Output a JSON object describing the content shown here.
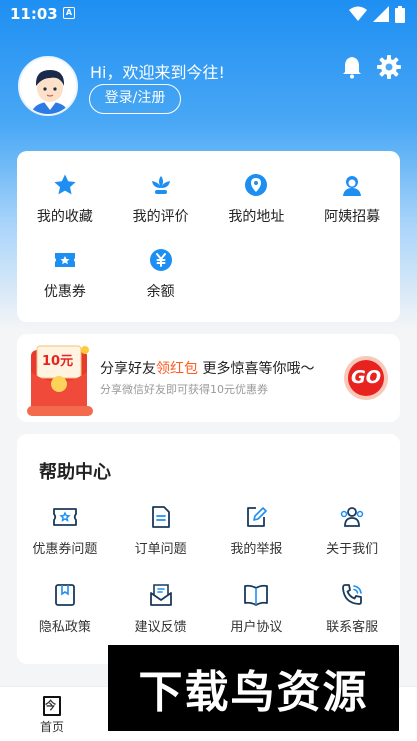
{
  "status_bar": {
    "time": "11:03",
    "indicator": "A"
  },
  "profile": {
    "greeting": "Hi，欢迎来到今往!",
    "login_label": "登录/注册"
  },
  "quick_actions": [
    {
      "label": "我的收藏",
      "icon": "star-icon"
    },
    {
      "label": "我的评价",
      "icon": "lotus-icon"
    },
    {
      "label": "我的地址",
      "icon": "location-pin-icon"
    },
    {
      "label": "阿姨招募",
      "icon": "nanny-icon"
    },
    {
      "label": "优惠券",
      "icon": "coupon-icon"
    },
    {
      "label": "余额",
      "icon": "yen-icon"
    }
  ],
  "promo": {
    "badge": "10元",
    "title_prefix": "分享好友",
    "title_highlight": "领红包",
    "title_suffix": " 更多惊喜等你哦～",
    "subtitle": "分享微信好友即可获得10元优惠券",
    "go_label": "GO"
  },
  "help": {
    "title": "帮助中心",
    "items": [
      {
        "label": "优惠券问题",
        "icon": "coupon-question-icon"
      },
      {
        "label": "订单问题",
        "icon": "order-doc-icon"
      },
      {
        "label": "我的举报",
        "icon": "report-edit-icon"
      },
      {
        "label": "关于我们",
        "icon": "team-icon"
      },
      {
        "label": "隐私政策",
        "icon": "privacy-bookmark-icon"
      },
      {
        "label": "建议反馈",
        "icon": "feedback-mail-icon"
      },
      {
        "label": "用户协议",
        "icon": "open-book-icon"
      },
      {
        "label": "联系客服",
        "icon": "phone-icon"
      }
    ]
  },
  "tabbar": {
    "tabs": [
      {
        "label": "首页",
        "glyph": "今"
      }
    ]
  },
  "watermark": "下载鸟资源",
  "colors": {
    "primary": "#1e8ff2",
    "accent_orange": "#ff5a1f",
    "go_red": "#e8231f"
  }
}
